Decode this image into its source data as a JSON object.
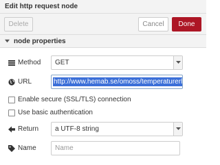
{
  "dialog": {
    "title": "Edit http request node"
  },
  "toolbar": {
    "delete_label": "Delete",
    "cancel_label": "Cancel",
    "done_label": "Done"
  },
  "section": {
    "title": "node properties"
  },
  "form": {
    "method": {
      "label": "Method",
      "value": "GET",
      "icon": "list-icon"
    },
    "url": {
      "label": "URL",
      "value": "http://www.hemab.se/omoss/temperaturerhamosa",
      "icon": "globe-icon"
    },
    "secure": {
      "label": "Enable secure (SSL/TLS) connection",
      "checked": false
    },
    "basic_auth": {
      "label": "Use basic authentication",
      "checked": false
    },
    "return": {
      "label": "Return",
      "value": "a UTF-8 string",
      "icon": "arrow-left-icon"
    },
    "name": {
      "label": "Name",
      "placeholder": "Name",
      "icon": "tag-icon"
    }
  },
  "colors": {
    "accent": "#ad1625",
    "selection": "#3b6fd8"
  }
}
